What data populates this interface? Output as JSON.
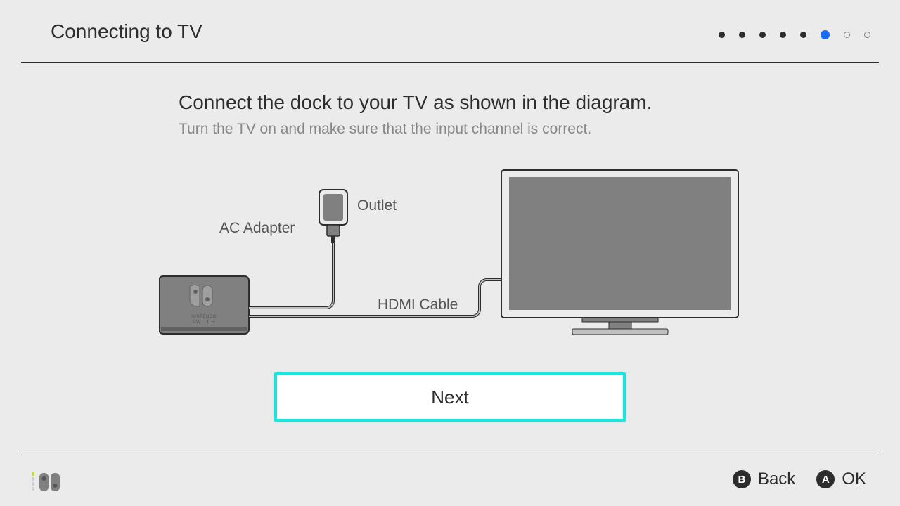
{
  "header": {
    "title": "Connecting to TV",
    "progress": {
      "total": 8,
      "current": 6
    }
  },
  "main": {
    "headline": "Connect the dock to your TV as shown in the diagram.",
    "sub": "Turn the TV on and make sure that the input channel is correct.",
    "labels": {
      "ac_adapter": "AC Adapter",
      "outlet": "Outlet",
      "hdmi": "HDMI Cable"
    },
    "dock_text": {
      "line1": "NINTENDO",
      "line2": "SWITCH"
    },
    "next_button": "Next"
  },
  "footer": {
    "hints": {
      "b": {
        "button": "B",
        "label": "Back"
      },
      "a": {
        "button": "A",
        "label": "OK"
      }
    }
  }
}
